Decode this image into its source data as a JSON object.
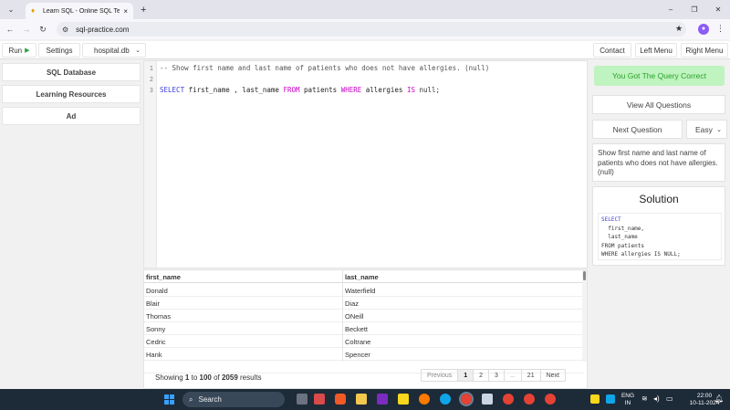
{
  "browser": {
    "tab_title": "Learn SQL - Online SQL Termin",
    "tab_close": "×",
    "new_tab": "+",
    "url": "sql-practice.com",
    "win_min": "–",
    "win_max": "❐",
    "win_close": "✕"
  },
  "toolbar": {
    "run_label": "Run",
    "settings_label": "Settings",
    "db_selected": "hospital.db",
    "contact_label": "Contact",
    "left_menu_label": "Left Menu",
    "right_menu_label": "Right Menu"
  },
  "sidebar": {
    "items": [
      {
        "label": "SQL Database"
      },
      {
        "label": "Learning Resources"
      },
      {
        "label": "Ad"
      }
    ]
  },
  "editor": {
    "line_numbers": [
      "1",
      "2",
      "3"
    ],
    "line1": "-- Show first name and last name of patients who does not have allergies. (null)",
    "line3": {
      "select_kw": "SELECT",
      "cols": " first_name , last_name ",
      "from_kw": "FROM",
      "table": " patients ",
      "where_kw": "WHERE",
      "col": " allergies ",
      "is_kw": "IS",
      "null_val": " null;"
    }
  },
  "results": {
    "columns": [
      "first_name",
      "last_name"
    ],
    "rows": [
      [
        "Donald",
        "Waterfield"
      ],
      [
        "Blair",
        "Diaz"
      ],
      [
        "Thomas",
        "ONeill"
      ],
      [
        "Sonny",
        "Beckett"
      ],
      [
        "Cedric",
        "Coltrane"
      ],
      [
        "Hank",
        "Spencer"
      ],
      [
        "",
        ""
      ]
    ],
    "showing_prefix": "Showing ",
    "range_start": "1",
    "range_to": " to ",
    "range_end": "100",
    "of_text": " of ",
    "total": "2059",
    "results_suffix": " results",
    "pagination": {
      "prev": "Previous",
      "pages": [
        "1",
        "2",
        "3",
        "...",
        "21"
      ],
      "next": "Next",
      "current": "1"
    }
  },
  "right_panel": {
    "correct_banner": "You Got The Query Correct",
    "view_all": "View All Questions",
    "next_question": "Next Question",
    "difficulty": "Easy",
    "question": "Show first name and last name of patients who does not have allergies. (null)",
    "solution_title": "Solution",
    "solution_lines": [
      "SELECT",
      "  first_name,",
      "  last_name",
      "FROM patients",
      "WHERE allergies IS NULL;"
    ]
  },
  "taskbar": {
    "search_label": "Search",
    "lang": "ENG",
    "region": "IN",
    "time": "22:00",
    "date": "10-11-2024"
  },
  "colors": {
    "correct_bg": "#bff3bf",
    "correct_fg": "#29a329",
    "keyword": "#3b3bd6",
    "run_green": "#25a244"
  }
}
